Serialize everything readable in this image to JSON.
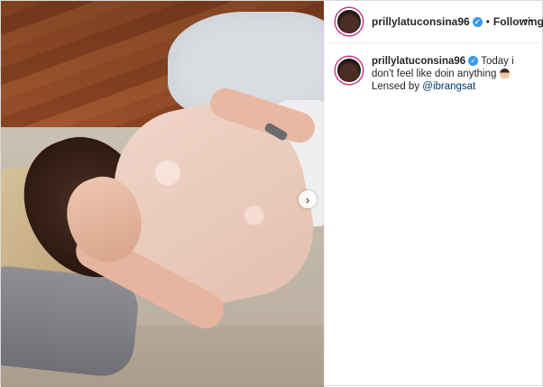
{
  "post": {
    "username": "prillylatuconsina96",
    "follow_label": "Following",
    "separator": "•",
    "more_label": "···",
    "next_label": "›"
  },
  "caption": {
    "username": "prillylatuconsina96",
    "text_before_emoji": "Today i don't feel like doin anything",
    "lensed_prefix": "Lensed by",
    "mention": "@ibrangsat"
  },
  "icons": {
    "verified": "✓"
  },
  "colors": {
    "verified": "#3897f0",
    "mention": "#00376b",
    "story_ring": "#c13584"
  }
}
